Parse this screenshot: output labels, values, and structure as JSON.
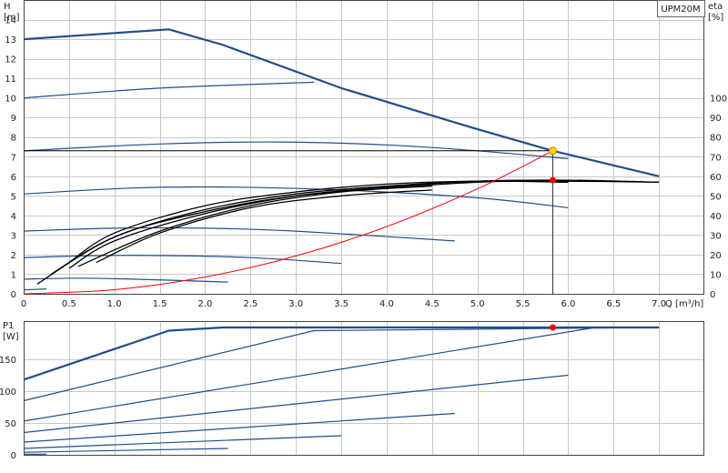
{
  "chart_data": [
    {
      "type": "line",
      "title": "UPM20M",
      "xlabel": "Q [m³/h]",
      "ylabel": "H [m]",
      "y2label": "eta [%]",
      "xlim": [
        0,
        7.5
      ],
      "ylim": [
        0,
        15
      ],
      "y2lim": [
        0,
        150
      ],
      "xticks": [
        "0",
        "0.5",
        "1.0",
        "1.5",
        "2.0",
        "2.5",
        "3.0",
        "3.5",
        "4.0",
        "4.5",
        "5.0",
        "5.5",
        "6.0",
        "6.5",
        "7.0"
      ],
      "yticks": [
        "0",
        "1",
        "2",
        "3",
        "4",
        "5",
        "6",
        "7",
        "8",
        "9",
        "10",
        "11",
        "12",
        "13",
        "14"
      ],
      "y2ticks": [
        "0",
        "10",
        "20",
        "30",
        "40",
        "50",
        "60",
        "70",
        "80",
        "90",
        "100"
      ],
      "grid": true,
      "max_curve": {
        "x": [
          0,
          1.6,
          2.2,
          3.5,
          5.0,
          5.83,
          7.0
        ],
        "y": [
          13.0,
          13.5,
          12.7,
          10.5,
          8.4,
          7.3,
          6.0
        ]
      },
      "setting_curves": [
        {
          "x": [
            0,
            1.5,
            3.2
          ],
          "y": [
            10.0,
            10.5,
            10.8
          ]
        },
        {
          "x": [
            0,
            1.5,
            2.8,
            4.0,
            5.0,
            6.0
          ],
          "y": [
            7.3,
            7.65,
            7.75,
            7.6,
            7.3,
            6.9
          ]
        },
        {
          "x": [
            0,
            1.2,
            2.2,
            3.5,
            5.0,
            6.0
          ],
          "y": [
            5.1,
            5.4,
            5.45,
            5.3,
            4.9,
            4.4
          ]
        },
        {
          "x": [
            0,
            1.0,
            2.0,
            3.0,
            4.75
          ],
          "y": [
            3.2,
            3.35,
            3.35,
            3.2,
            2.7
          ]
        },
        {
          "x": [
            0,
            0.8,
            1.6,
            2.5,
            3.5
          ],
          "y": [
            1.85,
            1.95,
            1.95,
            1.85,
            1.55
          ]
        },
        {
          "x": [
            0,
            0.6,
            1.2,
            2.25
          ],
          "y": [
            0.75,
            0.8,
            0.75,
            0.6
          ]
        },
        {
          "x": [
            0,
            0.25
          ],
          "y": [
            0.2,
            0.25
          ]
        }
      ],
      "operating_line": {
        "x": [
          0,
          5.83
        ],
        "y": [
          7.3,
          7.3
        ]
      },
      "system_curve": {
        "x": [
          0,
          1,
          2,
          3,
          4,
          5,
          5.83
        ],
        "y": [
          0,
          0.21,
          0.86,
          1.93,
          3.43,
          5.36,
          7.3
        ]
      },
      "efficiency_curves": [
        {
          "x": [
            0.15,
            1.0,
            2.0,
            3.0,
            4.0,
            5.0,
            5.5,
            6.0
          ],
          "y": [
            5,
            29,
            42,
            50,
            54,
            57,
            57.5,
            57
          ]
        },
        {
          "x": [
            0.3,
            1.0,
            2.0,
            3.0,
            4.0,
            5.0,
            6.0,
            7.0
          ],
          "y": [
            10,
            29,
            43,
            51,
            55,
            57.5,
            57.5,
            57
          ]
        },
        {
          "x": [
            0.5,
            1.0,
            2.0,
            3.0,
            4.0,
            5.0,
            6.0,
            7.0
          ],
          "y": [
            13,
            27,
            41,
            50,
            54.5,
            57.5,
            58,
            57
          ]
        },
        {
          "x": [
            0.5,
            1.0,
            2.0,
            3.0,
            4.0,
            5.0,
            6.0
          ],
          "y": [
            16,
            31,
            45,
            52,
            56,
            57.5,
            57
          ]
        },
        {
          "x": [
            0.8,
            1.5,
            2.5,
            3.5,
            4.5
          ],
          "y": [
            16,
            31,
            44,
            50,
            53
          ]
        },
        {
          "x": [
            0.6,
            1.5,
            2.5,
            3.5,
            4.5
          ],
          "y": [
            14,
            32,
            45,
            52,
            55
          ]
        }
      ],
      "duty_point": {
        "x": 5.83,
        "y": 7.3
      },
      "efficiency_point": {
        "x": 5.83,
        "y": 58
      },
      "colors": {
        "curves": "#1f4e8c",
        "efficiency": "#000000",
        "system": "#ff0000",
        "duty": "#ffd700",
        "point": "#ff0000"
      }
    },
    {
      "type": "line",
      "ylabel": "P1 [W]",
      "xlim": [
        0,
        7.5
      ],
      "ylim": [
        0,
        210
      ],
      "yticks": [
        "0",
        "50",
        "100",
        "150"
      ],
      "grid": true,
      "max_curve": {
        "x": [
          0,
          1.6,
          2.2,
          7.0
        ],
        "y": [
          118,
          195,
          200,
          200
        ]
      },
      "setting_curves": [
        {
          "x": [
            0,
            3.2,
            7.0
          ],
          "y": [
            85,
            195,
            200
          ]
        },
        {
          "x": [
            0,
            6.3
          ],
          "y": [
            53,
            200
          ]
        },
        {
          "x": [
            0,
            6.0
          ],
          "y": [
            35,
            125
          ]
        },
        {
          "x": [
            0,
            4.75
          ],
          "y": [
            20,
            65
          ]
        },
        {
          "x": [
            0,
            3.5
          ],
          "y": [
            10,
            30
          ]
        },
        {
          "x": [
            0,
            2.25
          ],
          "y": [
            4,
            10
          ]
        },
        {
          "x": [
            0,
            0.25
          ],
          "y": [
            1,
            1
          ]
        }
      ],
      "duty_point": {
        "x": 5.83,
        "y": 200
      },
      "colors": {
        "curves": "#1f4e8c",
        "point": "#ff0000"
      }
    }
  ]
}
